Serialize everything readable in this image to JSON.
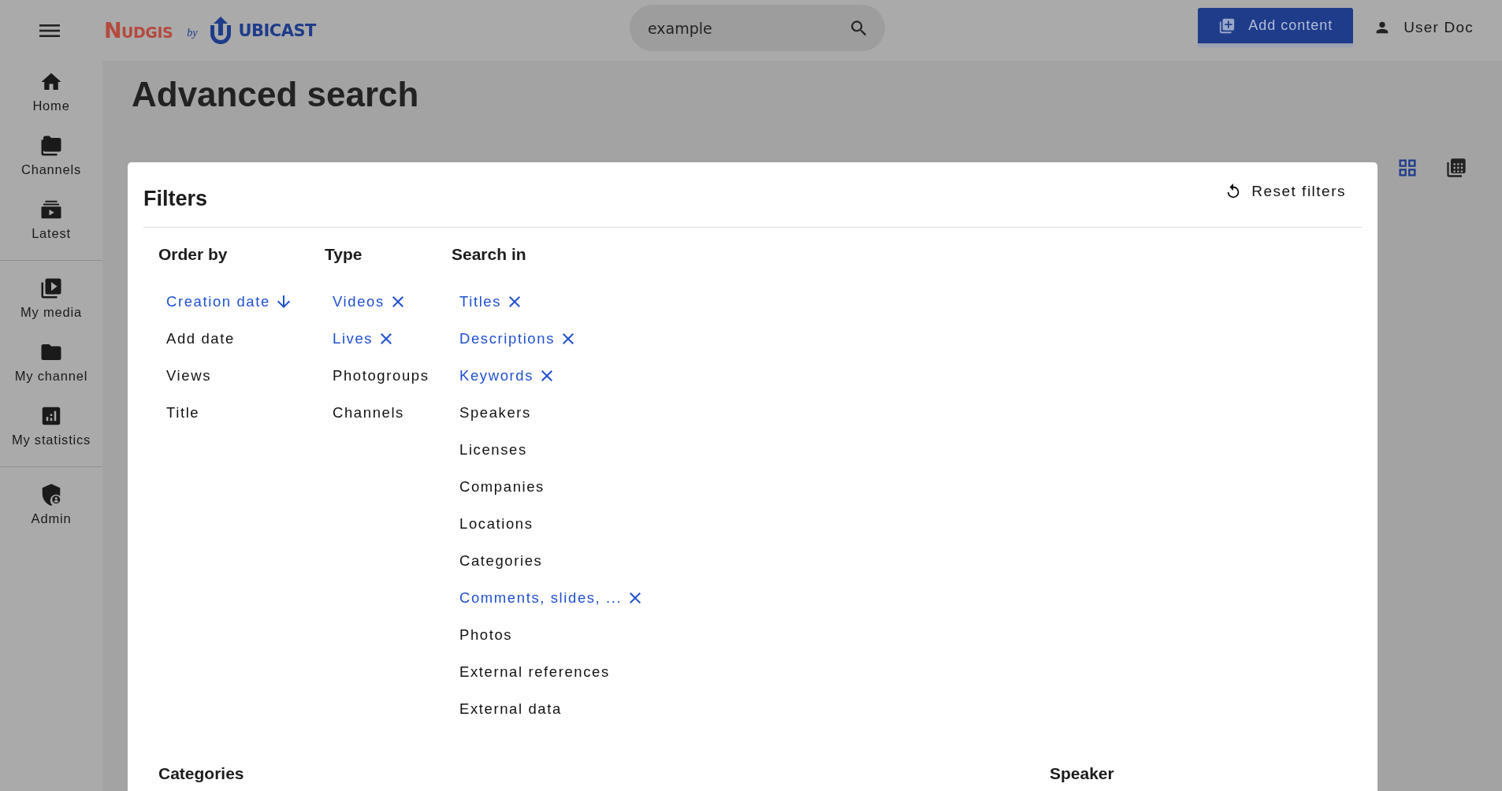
{
  "topbar": {
    "logo": {
      "brand": "NUDGIS",
      "by": "by",
      "company": "UBICAST"
    },
    "search": {
      "value": "example"
    },
    "add_button": "Add content",
    "user": "User Doc"
  },
  "sidebar": {
    "groups": [
      [
        {
          "label": "Home"
        },
        {
          "label": "Channels"
        },
        {
          "label": "Latest"
        }
      ],
      [
        {
          "label": "My media"
        },
        {
          "label": "My channel"
        },
        {
          "label": "My statistics"
        }
      ],
      [
        {
          "label": "Admin"
        }
      ]
    ]
  },
  "page": {
    "title": "Advanced search",
    "views": [
      {
        "kind": "grid",
        "selected": true
      },
      {
        "kind": "list",
        "selected": false
      }
    ]
  },
  "dialog": {
    "title": "Filters",
    "reset": "Reset filters",
    "columns": [
      {
        "heading": "Order by",
        "kind": "order",
        "items": [
          {
            "label": "Creation date",
            "selected": true
          },
          {
            "label": "Add date",
            "selected": false
          },
          {
            "label": "Views",
            "selected": false
          },
          {
            "label": "Title",
            "selected": false
          }
        ]
      },
      {
        "heading": "Type",
        "kind": "toggle",
        "items": [
          {
            "label": "Videos",
            "selected": true
          },
          {
            "label": "Lives",
            "selected": true
          },
          {
            "label": "Photogroups",
            "selected": false
          },
          {
            "label": "Channels",
            "selected": false
          }
        ]
      },
      {
        "heading": "Search in",
        "kind": "toggle",
        "items": [
          {
            "label": "Titles",
            "selected": true
          },
          {
            "label": "Descriptions",
            "selected": true
          },
          {
            "label": "Keywords",
            "selected": true
          },
          {
            "label": "Speakers",
            "selected": false
          },
          {
            "label": "Licenses",
            "selected": false
          },
          {
            "label": "Companies",
            "selected": false
          },
          {
            "label": "Locations",
            "selected": false
          },
          {
            "label": "Categories",
            "selected": false
          },
          {
            "label": "Comments, slides, ...",
            "selected": true
          },
          {
            "label": "Photos",
            "selected": false
          },
          {
            "label": "External references",
            "selected": false
          },
          {
            "label": "External data",
            "selected": false
          }
        ]
      }
    ],
    "sections": [
      "Categories",
      "Speaker"
    ]
  }
}
